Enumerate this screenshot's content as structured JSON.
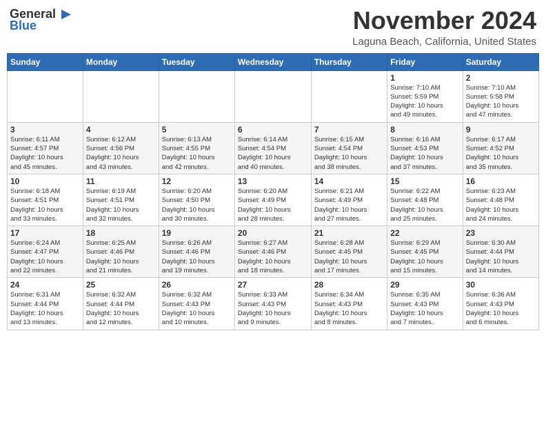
{
  "header": {
    "logo_line1": "General",
    "logo_line2": "Blue",
    "month": "November 2024",
    "location": "Laguna Beach, California, United States"
  },
  "weekdays": [
    "Sunday",
    "Monday",
    "Tuesday",
    "Wednesday",
    "Thursday",
    "Friday",
    "Saturday"
  ],
  "weeks": [
    [
      {
        "day": "",
        "info": ""
      },
      {
        "day": "",
        "info": ""
      },
      {
        "day": "",
        "info": ""
      },
      {
        "day": "",
        "info": ""
      },
      {
        "day": "",
        "info": ""
      },
      {
        "day": "1",
        "info": "Sunrise: 7:10 AM\nSunset: 5:59 PM\nDaylight: 10 hours\nand 49 minutes."
      },
      {
        "day": "2",
        "info": "Sunrise: 7:10 AM\nSunset: 5:58 PM\nDaylight: 10 hours\nand 47 minutes."
      }
    ],
    [
      {
        "day": "3",
        "info": "Sunrise: 6:11 AM\nSunset: 4:57 PM\nDaylight: 10 hours\nand 45 minutes."
      },
      {
        "day": "4",
        "info": "Sunrise: 6:12 AM\nSunset: 4:56 PM\nDaylight: 10 hours\nand 43 minutes."
      },
      {
        "day": "5",
        "info": "Sunrise: 6:13 AM\nSunset: 4:55 PM\nDaylight: 10 hours\nand 42 minutes."
      },
      {
        "day": "6",
        "info": "Sunrise: 6:14 AM\nSunset: 4:54 PM\nDaylight: 10 hours\nand 40 minutes."
      },
      {
        "day": "7",
        "info": "Sunrise: 6:15 AM\nSunset: 4:54 PM\nDaylight: 10 hours\nand 38 minutes."
      },
      {
        "day": "8",
        "info": "Sunrise: 6:16 AM\nSunset: 4:53 PM\nDaylight: 10 hours\nand 37 minutes."
      },
      {
        "day": "9",
        "info": "Sunrise: 6:17 AM\nSunset: 4:52 PM\nDaylight: 10 hours\nand 35 minutes."
      }
    ],
    [
      {
        "day": "10",
        "info": "Sunrise: 6:18 AM\nSunset: 4:51 PM\nDaylight: 10 hours\nand 33 minutes."
      },
      {
        "day": "11",
        "info": "Sunrise: 6:19 AM\nSunset: 4:51 PM\nDaylight: 10 hours\nand 32 minutes."
      },
      {
        "day": "12",
        "info": "Sunrise: 6:20 AM\nSunset: 4:50 PM\nDaylight: 10 hours\nand 30 minutes."
      },
      {
        "day": "13",
        "info": "Sunrise: 6:20 AM\nSunset: 4:49 PM\nDaylight: 10 hours\nand 28 minutes."
      },
      {
        "day": "14",
        "info": "Sunrise: 6:21 AM\nSunset: 4:49 PM\nDaylight: 10 hours\nand 27 minutes."
      },
      {
        "day": "15",
        "info": "Sunrise: 6:22 AM\nSunset: 4:48 PM\nDaylight: 10 hours\nand 25 minutes."
      },
      {
        "day": "16",
        "info": "Sunrise: 6:23 AM\nSunset: 4:48 PM\nDaylight: 10 hours\nand 24 minutes."
      }
    ],
    [
      {
        "day": "17",
        "info": "Sunrise: 6:24 AM\nSunset: 4:47 PM\nDaylight: 10 hours\nand 22 minutes."
      },
      {
        "day": "18",
        "info": "Sunrise: 6:25 AM\nSunset: 4:46 PM\nDaylight: 10 hours\nand 21 minutes."
      },
      {
        "day": "19",
        "info": "Sunrise: 6:26 AM\nSunset: 4:46 PM\nDaylight: 10 hours\nand 19 minutes."
      },
      {
        "day": "20",
        "info": "Sunrise: 6:27 AM\nSunset: 4:46 PM\nDaylight: 10 hours\nand 18 minutes."
      },
      {
        "day": "21",
        "info": "Sunrise: 6:28 AM\nSunset: 4:45 PM\nDaylight: 10 hours\nand 17 minutes."
      },
      {
        "day": "22",
        "info": "Sunrise: 6:29 AM\nSunset: 4:45 PM\nDaylight: 10 hours\nand 15 minutes."
      },
      {
        "day": "23",
        "info": "Sunrise: 6:30 AM\nSunset: 4:44 PM\nDaylight: 10 hours\nand 14 minutes."
      }
    ],
    [
      {
        "day": "24",
        "info": "Sunrise: 6:31 AM\nSunset: 4:44 PM\nDaylight: 10 hours\nand 13 minutes."
      },
      {
        "day": "25",
        "info": "Sunrise: 6:32 AM\nSunset: 4:44 PM\nDaylight: 10 hours\nand 12 minutes."
      },
      {
        "day": "26",
        "info": "Sunrise: 6:32 AM\nSunset: 4:43 PM\nDaylight: 10 hours\nand 10 minutes."
      },
      {
        "day": "27",
        "info": "Sunrise: 6:33 AM\nSunset: 4:43 PM\nDaylight: 10 hours\nand 9 minutes."
      },
      {
        "day": "28",
        "info": "Sunrise: 6:34 AM\nSunset: 4:43 PM\nDaylight: 10 hours\nand 8 minutes."
      },
      {
        "day": "29",
        "info": "Sunrise: 6:35 AM\nSunset: 4:43 PM\nDaylight: 10 hours\nand 7 minutes."
      },
      {
        "day": "30",
        "info": "Sunrise: 6:36 AM\nSunset: 4:43 PM\nDaylight: 10 hours\nand 6 minutes."
      }
    ]
  ]
}
